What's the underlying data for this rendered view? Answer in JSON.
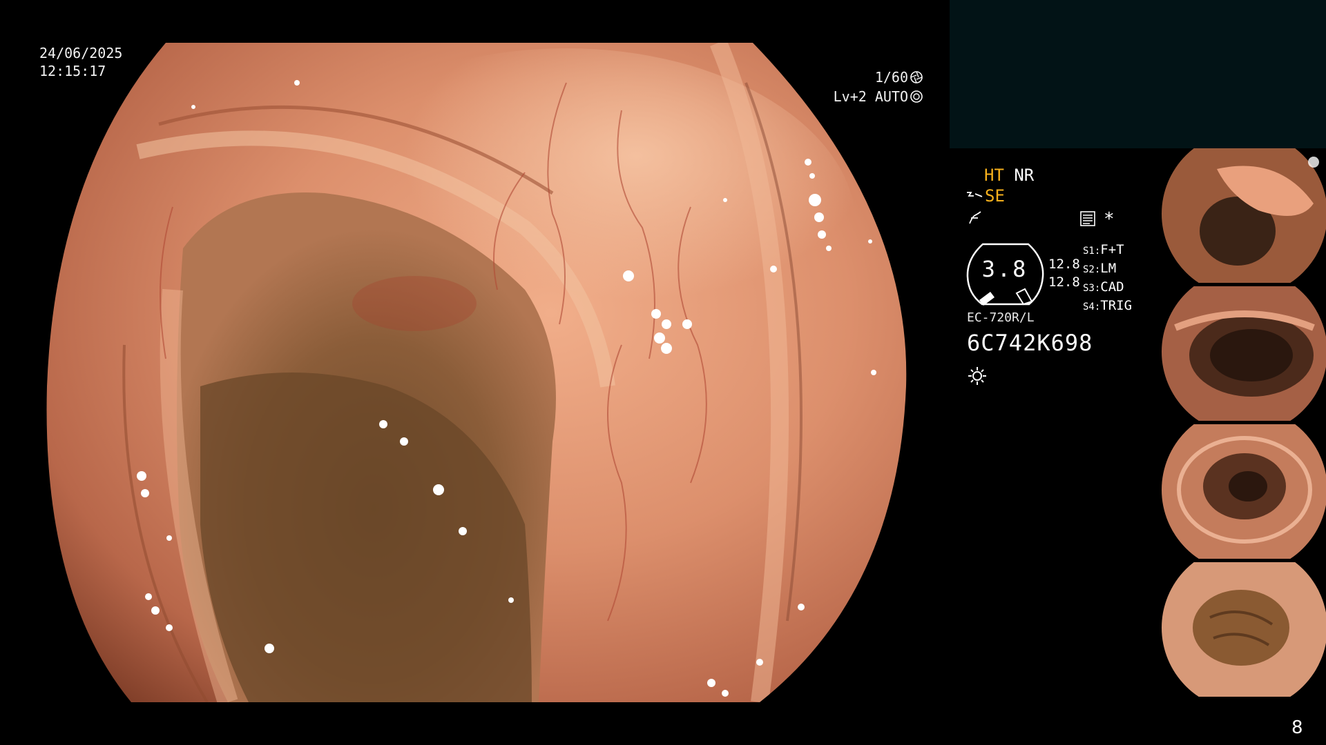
{
  "overlay": {
    "date": "24/06/2025",
    "time": "12:15:17",
    "shutter": "1/60",
    "exposure": "Lv+2 AUTO"
  },
  "info": {
    "ht": "HT",
    "nr": "NR",
    "se": "SE",
    "gauge_value": "3.8",
    "gauge_upper": "12.8",
    "gauge_lower": "12.8",
    "s_keys": [
      "S1:",
      "S2:",
      "S3:",
      "S4:"
    ],
    "s_values": [
      "F+T",
      "LM",
      "CAD",
      "TRIG"
    ],
    "asterisk": "*",
    "scope_model": "EC-720R/L",
    "serial": "6C742K698"
  },
  "icons": {
    "shutter": "aperture-icon",
    "auto": "iris-auto-icon",
    "structure": "structure-enhance-icon",
    "color": "color-enhance-icon",
    "record": "record-list-icon",
    "light": "light-icon"
  },
  "colors": {
    "accent": "#f6b01c",
    "top_panel": "#021316",
    "mucosa": "#d68a6a"
  },
  "page": "8"
}
